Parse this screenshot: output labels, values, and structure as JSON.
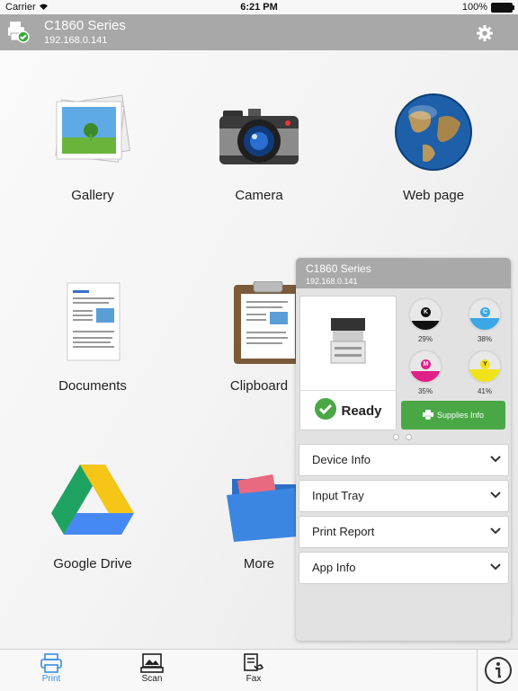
{
  "statusbar": {
    "carrier": "Carrier",
    "time": "6:21 PM",
    "battery": "100%"
  },
  "header": {
    "title": "C1860 Series",
    "ip": "192.168.0.141"
  },
  "tiles": [
    {
      "label": "Gallery",
      "icon": "gallery-icon"
    },
    {
      "label": "Camera",
      "icon": "camera-icon"
    },
    {
      "label": "Web page",
      "icon": "globe-icon"
    },
    {
      "label": "Documents",
      "icon": "documents-icon"
    },
    {
      "label": "Clipboard",
      "icon": "clipboard-icon"
    },
    {
      "label": "Google Drive",
      "icon": "google-drive-icon"
    },
    {
      "label": "More",
      "icon": "folder-icon"
    }
  ],
  "panel": {
    "title": "C1860 Series",
    "ip": "192.168.0.141",
    "status": "Ready",
    "toners": [
      {
        "letter": "K",
        "percent": "29%",
        "level": 0.29,
        "color": "#111111"
      },
      {
        "letter": "C",
        "percent": "38%",
        "level": 0.38,
        "color": "#3aa8e6"
      },
      {
        "letter": "M",
        "percent": "35%",
        "level": 0.35,
        "color": "#e0218a"
      },
      {
        "letter": "Y",
        "percent": "41%",
        "level": 0.41,
        "color": "#f2e21a"
      }
    ],
    "supplies_label": "Supplies Info",
    "sections": [
      "Device Info",
      "Input Tray",
      "Print Report",
      "App Info"
    ]
  },
  "tabbar": {
    "tabs": [
      "Print",
      "Scan",
      "Fax"
    ],
    "active": "Print"
  },
  "colors": {
    "accent": "#3a8de0",
    "ready_green": "#49a845",
    "header_gray": "#a8a8a8"
  }
}
